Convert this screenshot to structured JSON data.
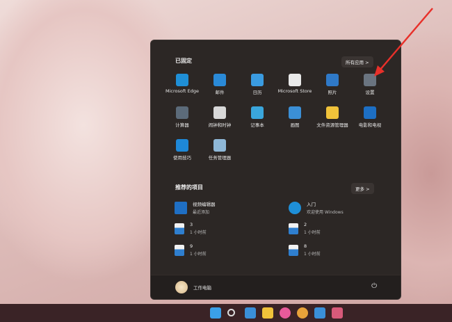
{
  "pinned": {
    "title": "已固定",
    "all_apps": "所有应用",
    "chevron": ">",
    "apps": [
      {
        "label": "Microsoft Edge",
        "icon": "edge-icon",
        "color": "#1f8fd6"
      },
      {
        "label": "邮件",
        "icon": "mail-icon",
        "color": "#2a8ad8"
      },
      {
        "label": "日历",
        "icon": "calendar-icon",
        "color": "#3a9be0"
      },
      {
        "label": "Microsoft Store",
        "icon": "store-icon",
        "color": "#e9e9e9"
      },
      {
        "label": "照片",
        "icon": "photos-icon",
        "color": "#2f79c8"
      },
      {
        "label": "设置",
        "icon": "settings-gear-icon",
        "color": "#6a7480"
      },
      {
        "label": "计算器",
        "icon": "calculator-icon",
        "color": "#5c6b7a"
      },
      {
        "label": "闹钟和时钟",
        "icon": "alarm-clock-icon",
        "color": "#d8d8d8"
      },
      {
        "label": "记事本",
        "icon": "notepad-icon",
        "color": "#3aa6dc"
      },
      {
        "label": "画图",
        "icon": "paint-icon",
        "color": "#3b8fd6"
      },
      {
        "label": "文件资源管理器",
        "icon": "folder-icon",
        "color": "#f0c23a"
      },
      {
        "label": "电影和电视",
        "icon": "movies-tv-icon",
        "color": "#1d6fc4"
      },
      {
        "label": "使用技巧",
        "icon": "tips-icon",
        "color": "#1e88d8"
      },
      {
        "label": "任务管理器",
        "icon": "task-manager-icon",
        "color": "#8fb8d8"
      }
    ]
  },
  "recommended": {
    "title": "推荐的项目",
    "more": "更多",
    "chevron": ">",
    "items": [
      {
        "name": "视频编辑器",
        "sub": "最近添加",
        "icon": "video-editor-icon"
      },
      {
        "name": "入门",
        "sub": "欢迎使用 Windows",
        "icon": "get-started-icon"
      },
      {
        "name": "3",
        "sub": "1 小时前",
        "icon": "image-file-icon"
      },
      {
        "name": "2",
        "sub": "1 小时前",
        "icon": "image-file-icon"
      },
      {
        "name": "9",
        "sub": "1 小时前",
        "icon": "image-file-icon"
      },
      {
        "name": "8",
        "sub": "1 小时前",
        "icon": "image-file-icon"
      }
    ]
  },
  "user": {
    "name": "工作电脑"
  },
  "power_symbol": "⏻",
  "taskbar": [
    "start-icon",
    "search-icon",
    "widgets-icon",
    "file-explorer-icon",
    "photos-app-icon",
    "chrome-icon",
    "paint-app-icon",
    "app-icon"
  ],
  "colors": {
    "menu_bg": "#2c2725",
    "taskbar_bg": "#3a2326",
    "annotation_arrow": "#e8302a"
  }
}
